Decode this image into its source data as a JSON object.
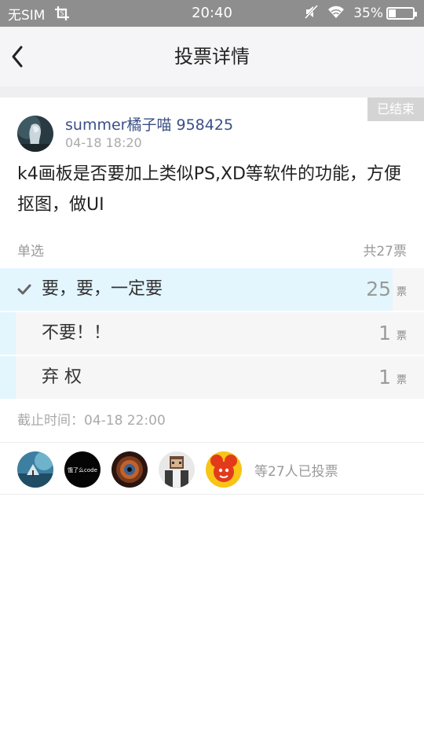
{
  "statusbar": {
    "carrier": "无SIM",
    "time": "20:40",
    "battery": "35%",
    "battery_level": 0.35
  },
  "nav": {
    "title": "投票详情"
  },
  "post": {
    "status_tag": "已结束",
    "author": "summer橘子喵 958425",
    "time": "04-18 18:20",
    "question": "k4画板是否要加上类似PS,XD等软件的功能，方便抠图，做UI"
  },
  "vote": {
    "type": "单选",
    "total": "共27票",
    "options": [
      {
        "label": "要，要，一定要",
        "count": "25",
        "unit": "票",
        "fraction": 0.926,
        "selected": true
      },
      {
        "label": "不要！！",
        "count": "1",
        "unit": "票",
        "fraction": 0.037,
        "selected": false
      },
      {
        "label": "弃 权",
        "count": "1",
        "unit": "票",
        "fraction": 0.037,
        "selected": false
      }
    ],
    "deadline": "截止时间：04-18 22:00"
  },
  "voters": {
    "summary": "等27人已投票",
    "avatar_text_2": "饿了么code"
  },
  "colors": {
    "accent_fill": "#e3f6fe",
    "author_blue": "#3b4f86",
    "statusbar": "#8e8e8e"
  }
}
